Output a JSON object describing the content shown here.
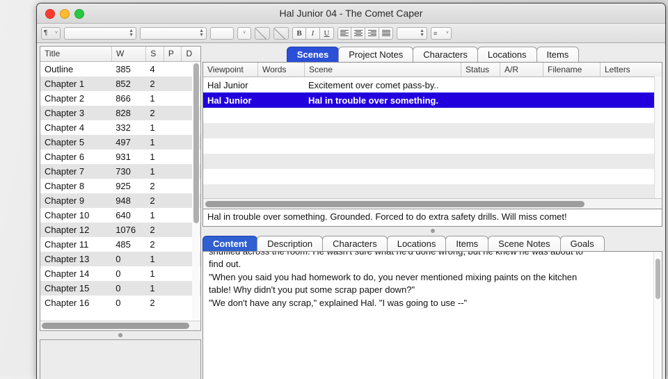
{
  "window": {
    "title": "Hal Junior 04 - The Comet Caper",
    "traffic_lights": [
      "close-button",
      "minimize-button",
      "maximize-button"
    ]
  },
  "toolbar": {
    "paragraph_style": "¶",
    "font_name": "",
    "character_style": "",
    "font_size": "",
    "bold_label": "B",
    "italic_label": "I",
    "underline_label": "U",
    "line_spacing": "",
    "list_glyph": "≡",
    "caret": "˅"
  },
  "binder": {
    "columns": [
      "Title",
      "W",
      "S",
      "P",
      "D"
    ],
    "rows": [
      {
        "title": "Outline",
        "w": "385",
        "s": "4",
        "p": "",
        "d": ""
      },
      {
        "title": "Chapter 1",
        "w": "852",
        "s": "2",
        "p": "",
        "d": ""
      },
      {
        "title": "Chapter 2",
        "w": "866",
        "s": "1",
        "p": "",
        "d": ""
      },
      {
        "title": "Chapter 3",
        "w": "828",
        "s": "2",
        "p": "",
        "d": ""
      },
      {
        "title": "Chapter 4",
        "w": "332",
        "s": "1",
        "p": "",
        "d": ""
      },
      {
        "title": "Chapter 5",
        "w": "497",
        "s": "1",
        "p": "",
        "d": ""
      },
      {
        "title": "Chapter 6",
        "w": "931",
        "s": "1",
        "p": "",
        "d": ""
      },
      {
        "title": "Chapter 7",
        "w": "730",
        "s": "1",
        "p": "",
        "d": ""
      },
      {
        "title": "Chapter 8",
        "w": "925",
        "s": "2",
        "p": "",
        "d": ""
      },
      {
        "title": "Chapter 9",
        "w": "948",
        "s": "2",
        "p": "",
        "d": ""
      },
      {
        "title": "Chapter 10",
        "w": "640",
        "s": "1",
        "p": "",
        "d": ""
      },
      {
        "title": "Chapter 12",
        "w": "1076",
        "s": "2",
        "p": "",
        "d": ""
      },
      {
        "title": "Chapter 11",
        "w": "485",
        "s": "2",
        "p": "",
        "d": ""
      },
      {
        "title": "Chapter 13",
        "w": "0",
        "s": "1",
        "p": "",
        "d": ""
      },
      {
        "title": "Chapter 14",
        "w": "0",
        "s": "1",
        "p": "",
        "d": ""
      },
      {
        "title": "Chapter 15",
        "w": "0",
        "s": "1",
        "p": "",
        "d": ""
      },
      {
        "title": "Chapter 16",
        "w": "0",
        "s": "2",
        "p": "",
        "d": ""
      }
    ]
  },
  "upper_tabs": [
    {
      "label": "Scenes",
      "active": true
    },
    {
      "label": "Project Notes",
      "active": false
    },
    {
      "label": "Characters",
      "active": false
    },
    {
      "label": "Locations",
      "active": false
    },
    {
      "label": "Items",
      "active": false
    }
  ],
  "scene_table": {
    "columns": [
      "Viewpoint",
      "Words",
      "Scene",
      "Status",
      "A/R",
      "Filename",
      "Letters"
    ],
    "rows": [
      {
        "viewpoint": "Hal Junior",
        "words": "",
        "scene": "Excitement over comet pass-by..",
        "status": "",
        "ar": "",
        "filename": "",
        "letters": "",
        "selected": false
      },
      {
        "viewpoint": "Hal Junior",
        "words": "",
        "scene": "Hal in trouble over something.",
        "status": "",
        "ar": "",
        "filename": "",
        "letters": "",
        "selected": true
      }
    ]
  },
  "synopsis": "Hal in trouble over something. Grounded. Forced to do extra safety drills. Will miss comet!",
  "lower_tabs": [
    {
      "label": "Content",
      "active": true
    },
    {
      "label": "Description",
      "active": false
    },
    {
      "label": "Characters",
      "active": false
    },
    {
      "label": "Locations",
      "active": false
    },
    {
      "label": "Items",
      "active": false
    },
    {
      "label": "Scene Notes",
      "active": false
    },
    {
      "label": "Goals",
      "active": false
    }
  ],
  "editor": {
    "lines": [
      "shuffled across the room. He wasn't sure what he'd done wrong, but he knew he was about to",
      "find out.",
      "\"When you said you had homework to do, you never mentioned mixing paints on the kitchen",
      "table! Why didn't you put some scrap paper down?\"",
      "\"We don't have any scrap,\" explained Hal. \"I was going to use --\""
    ]
  },
  "colors": {
    "selection_blue": "#2200dd",
    "tab_blue": "#2b50d8",
    "lower_tab_blue": "#2f5fd0",
    "window_chrome": "#ececec"
  }
}
